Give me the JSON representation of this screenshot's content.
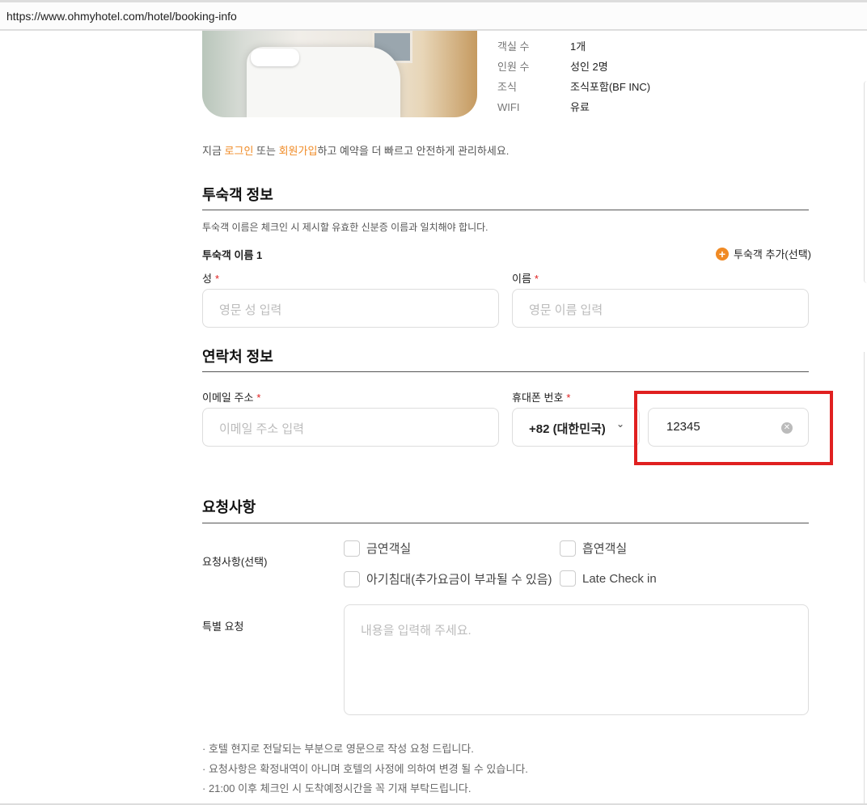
{
  "browser": {
    "url": "https://www.ohmyhotel.com/hotel/booking-info"
  },
  "room_info": [
    {
      "label": "객실 수",
      "value": "1개"
    },
    {
      "label": "인원 수",
      "value": "성인 2명"
    },
    {
      "label": "조식",
      "value": "조식포함(BF INC)"
    },
    {
      "label": "WIFI",
      "value": "유료"
    }
  ],
  "notice": {
    "pre": "지금 ",
    "login": "로그인",
    "mid": " 또는 ",
    "signup": "회원가입",
    "post": "하고 예약을 더 빠르고 안전하게 관리하세요."
  },
  "guest": {
    "title": "투숙객 정보",
    "desc": "투숙객 이름은 체크인 시 제시할 유효한 신분증 이름과 일치해야 합니다.",
    "guest_label": "투숙객 이름 1",
    "add_guest": "투숙객 추가(선택)",
    "last_name_label": "성",
    "last_name_placeholder": "영문 성 입력",
    "first_name_label": "이름",
    "first_name_placeholder": "영문 이름 입력",
    "required": "*"
  },
  "contact": {
    "title": "연락처 정보",
    "email_label": "이메일 주소",
    "email_placeholder": "이메일 주소 입력",
    "phone_label": "휴대폰 번호",
    "country_code": "+82 (대한민국)",
    "phone_value": "12345"
  },
  "requests": {
    "title": "요청사항",
    "options_label": "요청사항(선택)",
    "options": [
      "금연객실",
      "흡연객실",
      "아기침대(추가요금이 부과될 수 있음)",
      "Late Check in"
    ],
    "special_label": "특별 요청",
    "special_placeholder": "내용을 입력해 주세요.",
    "bullets": [
      "호텔 현지로 전달되는 부분으로 영문으로 작성 요청 드립니다.",
      "요청사항은 확정내역이 아니며 호텔의 사정에 의하여 변경 될 수 있습니다.",
      "21:00 이후 체크인 시 도착예정시간을 꼭 기재 부탁드립니다."
    ]
  },
  "colors": {
    "accent": "#f08a24",
    "highlight": "#e02020"
  }
}
